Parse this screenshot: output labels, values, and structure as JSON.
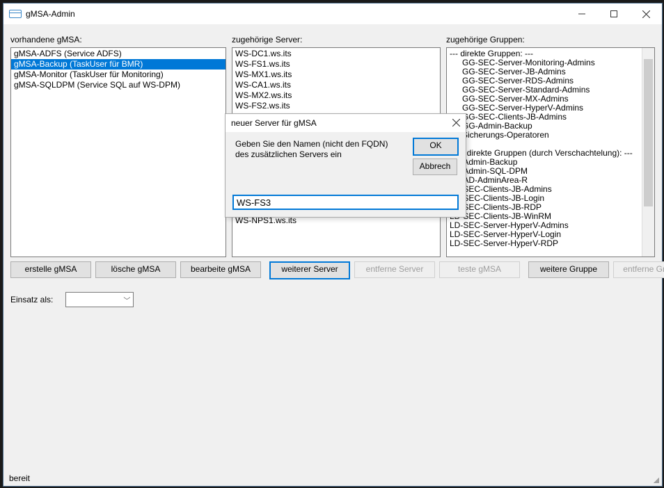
{
  "window": {
    "title": "gMSA-Admin"
  },
  "labels": {
    "gmsa_list": "vorhandene gMSA:",
    "server_list": "zugehörige Server:",
    "group_list": "zugehörige Gruppen:",
    "einsatz": "Einsatz als:"
  },
  "gmsa_items": [
    {
      "text": "gMSA-ADFS (Service ADFS)",
      "selected": false
    },
    {
      "text": "gMSA-Backup (TaskUser für BMR)",
      "selected": true
    },
    {
      "text": "gMSA-Monitor (TaskUser für Monitoring)",
      "selected": false
    },
    {
      "text": "gMSA-SQLDPM (Service SQL auf WS-DPM)",
      "selected": false
    }
  ],
  "server_items": [
    "WS-DC1.ws.its",
    "WS-FS1.ws.its",
    "WS-MX1.ws.its",
    "WS-CA1.ws.its",
    "WS-MX2.ws.its",
    "WS-FS2.ws.its"
  ],
  "server_items_tail": [
    "WS-NPS1.ws.its"
  ],
  "group_items": [
    {
      "t": "--- direkte Gruppen: ---",
      "indent": false
    },
    {
      "t": "GG-SEC-Server-Monitoring-Admins",
      "indent": true
    },
    {
      "t": "GG-SEC-Server-JB-Admins",
      "indent": true
    },
    {
      "t": "GG-SEC-Server-RDS-Admins",
      "indent": true
    },
    {
      "t": "GG-SEC-Server-Standard-Admins",
      "indent": true
    },
    {
      "t": "GG-SEC-Server-MX-Admins",
      "indent": true
    },
    {
      "t": "GG-SEC-Server-HyperV-Admins",
      "indent": true
    },
    {
      "t": "GG-SEC-Clients-JB-Admins",
      "indent": true
    },
    {
      "t": "GG-Admin-Backup",
      "indent": true
    },
    {
      "t": "Sicherungs-Operatoren",
      "indent": true
    },
    {
      "t": "",
      "indent": false
    },
    {
      "t": "--- indirekte Gruppen (durch Verschachtelung): ---",
      "indent": false
    },
    {
      "t": "LD-Admin-Backup",
      "indent": false
    },
    {
      "t": "LD-Admin-SQL-DPM",
      "indent": false
    },
    {
      "t": "LD-AD-AdminArea-R",
      "indent": false
    },
    {
      "t": "LD-SEC-Clients-JB-Admins",
      "indent": false
    },
    {
      "t": "LD-SEC-Clients-JB-Login",
      "indent": false
    },
    {
      "t": "LD-SEC-Clients-JB-RDP",
      "indent": false
    },
    {
      "t": "LD-SEC-Clients-JB-WinRM",
      "indent": false
    },
    {
      "t": "LD-SEC-Server-HyperV-Admins",
      "indent": false
    },
    {
      "t": "LD-SEC-Server-HyperV-Login",
      "indent": false
    },
    {
      "t": "LD-SEC-Server-HyperV-RDP",
      "indent": false
    }
  ],
  "buttons": {
    "create": "erstelle gMSA",
    "delete": "lösche gMSA",
    "edit": "bearbeite gMSA",
    "add_server": "weiterer Server",
    "remove_server": "entferne Server",
    "test": "teste gMSA",
    "add_group": "weitere Gruppe",
    "remove_group": "entferne Gruppe"
  },
  "status": "bereit",
  "dialog": {
    "title": "neuer Server für gMSA",
    "text": "Geben Sie den Namen (nicht den FQDN) des zusätzlichen Servers ein",
    "ok": "OK",
    "cancel": "Abbrech",
    "input_value": "WS-FS3"
  }
}
